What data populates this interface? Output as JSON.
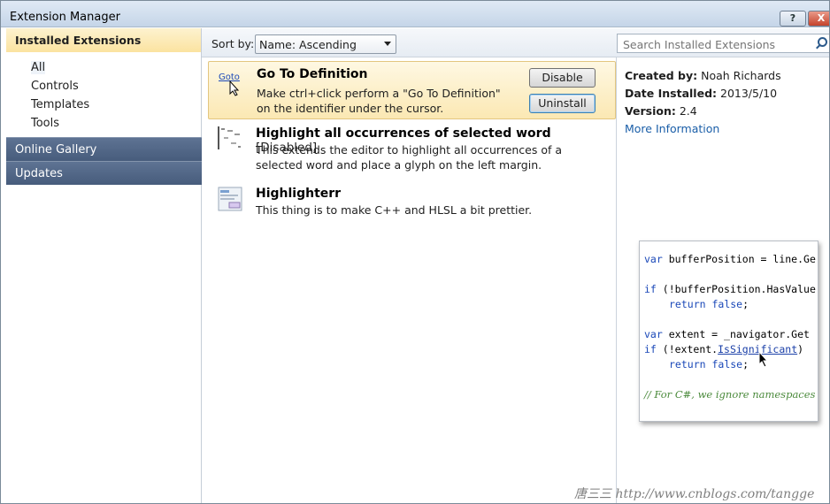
{
  "window": {
    "title": "Extension Manager",
    "help_label": "?",
    "close_label": "X"
  },
  "sidebar": {
    "header": "Installed Extensions",
    "subitems": [
      {
        "label": "All"
      },
      {
        "label": "Controls"
      },
      {
        "label": "Templates"
      },
      {
        "label": "Tools"
      }
    ],
    "nav": [
      {
        "label": "Online Gallery"
      },
      {
        "label": "Updates"
      }
    ]
  },
  "toolbar": {
    "sort_label": "Sort by:",
    "sort_value": "Name: Ascending",
    "search_placeholder": "Search Installed Extensions"
  },
  "extensions": [
    {
      "name": "Go To Definition",
      "description": "Make ctrl+click perform a \"Go To Definition\" on the identifier under the cursor.",
      "icon_text": "Goto",
      "disable_label": "Disable",
      "uninstall_label": "Uninstall"
    },
    {
      "name": "Highlight all occurrences of selected word",
      "status": "[Disabled]",
      "description": "This extends the editor to highlight all occurrences of a selected word and place a glyph on the left margin."
    },
    {
      "name": "Highlighterr",
      "description": "This thing is to make C++ and HLSL a bit prettier."
    }
  ],
  "details": {
    "created_by_label": "Created by:",
    "created_by": "Noah Richards",
    "date_label": "Date Installed:",
    "date": "2013/5/10",
    "version_label": "Version:",
    "version": "2.4",
    "more_info": "More Information"
  },
  "preview": {
    "l1_kw": "var",
    "l1": " bufferPosition = line.Ge",
    "l2_kw": "if",
    "l2": " (!bufferPosition.HasValue",
    "l3_kw": "return",
    "l3_kw2": "false",
    "l3": ";",
    "l4_kw": "var",
    "l4": " extent = _navigator.Get",
    "l5_kw": "if",
    "l5a": " (!extent.",
    "l5_link": "IsSignificant",
    "l5b": ")",
    "l6_kw": "return",
    "l6_kw2": "false",
    "l6": ";",
    "l7_comment": "// For C#, we ignore namespaces afte"
  },
  "watermark": "唐三三  http://www.cnblogs.com/tangge",
  "colors": {
    "selected_item": "#fbe8b3",
    "nav_bar": "#4f6585",
    "link": "#1a5ea8"
  }
}
